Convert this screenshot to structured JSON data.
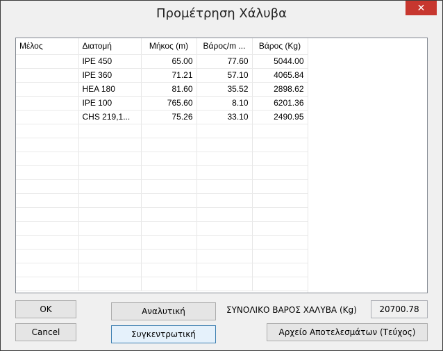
{
  "window": {
    "title": "Προμέτρηση Χάλυβα",
    "close_glyph": "✕"
  },
  "table": {
    "headers": [
      "Μέλος",
      "Διατομή",
      "Μήκος (m)",
      "Βάρος/m ...",
      "Βάρος (Kg)"
    ],
    "rows": [
      [
        "",
        "IPE 450",
        "65.00",
        "77.60",
        "5044.00"
      ],
      [
        "",
        "IPE 360",
        "71.21",
        "57.10",
        "4065.84"
      ],
      [
        "",
        "HEA 180",
        "81.60",
        "35.52",
        "2898.62"
      ],
      [
        "",
        "IPE 100",
        "765.60",
        "8.10",
        "6201.36"
      ],
      [
        "",
        "CHS 219,1...",
        "75.26",
        "33.10",
        "2490.95"
      ],
      [
        "",
        "",
        "",
        "",
        ""
      ],
      [
        "",
        "",
        "",
        "",
        ""
      ],
      [
        "",
        "",
        "",
        "",
        ""
      ],
      [
        "",
        "",
        "",
        "",
        ""
      ],
      [
        "",
        "",
        "",
        "",
        ""
      ],
      [
        "",
        "",
        "",
        "",
        ""
      ],
      [
        "",
        "",
        "",
        "",
        ""
      ],
      [
        "",
        "",
        "",
        "",
        ""
      ],
      [
        "",
        "",
        "",
        "",
        ""
      ],
      [
        "",
        "",
        "",
        "",
        ""
      ],
      [
        "",
        "",
        "",
        "",
        ""
      ],
      [
        "",
        "",
        "",
        "",
        ""
      ]
    ]
  },
  "buttons": {
    "ok": "OK",
    "cancel": "Cancel",
    "analytic": "Αναλυτική",
    "summary": "Συγκεντρωτική",
    "results_file": "Αρχείο Αποτελεσμάτων (Τεύχος)"
  },
  "total": {
    "label": "ΣΥΝΟΛΙΚΟ ΒΑΡΟΣ ΧΑΛΥΒΑ (Kg)",
    "value": "20700.78"
  }
}
